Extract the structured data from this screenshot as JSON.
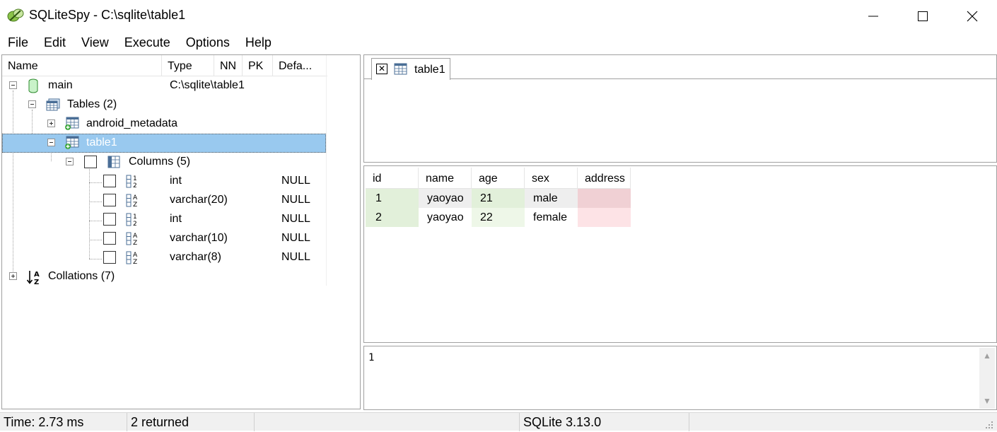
{
  "window": {
    "title": "SQLiteSpy - C:\\sqlite\\table1"
  },
  "menu": [
    "File",
    "Edit",
    "View",
    "Execute",
    "Options",
    "Help"
  ],
  "tree": {
    "columns": [
      "Name",
      "Type",
      "NN",
      "PK",
      "Defa..."
    ],
    "main": {
      "label": "main",
      "path": "C:\\sqlite\\table1"
    },
    "tables": {
      "label": "Tables (2)"
    },
    "android_metadata": {
      "label": "android_metadata"
    },
    "table1": {
      "label": "table1"
    },
    "columns_node": {
      "label": "Columns (5)"
    },
    "column_rows": [
      {
        "type": "int",
        "default": "NULL",
        "icon": "numeric-field-icon"
      },
      {
        "type": "varchar(20)",
        "default": "NULL",
        "icon": "text-field-icon"
      },
      {
        "type": "int",
        "default": "NULL",
        "icon": "numeric-field-icon"
      },
      {
        "type": "varchar(10)",
        "default": "NULL",
        "icon": "text-field-icon"
      },
      {
        "type": "varchar(8)",
        "default": "NULL",
        "icon": "text-field-icon"
      }
    ],
    "collations": {
      "label": "Collations (7)"
    }
  },
  "tab": {
    "label": "table1"
  },
  "grid": {
    "headers": [
      "id",
      "name",
      "age",
      "sex",
      "address"
    ],
    "rows": [
      [
        "1",
        "yaoyao",
        "21",
        "male",
        ""
      ],
      [
        "2",
        "yaoyao",
        "22",
        "female",
        ""
      ]
    ],
    "colors": {
      "int_cell": "#e2f0da",
      "int_cell_alt": "#eef7e8",
      "text_cell": "#eeeeee",
      "null_cell": "#f0d0d4",
      "null_cell_alt": "#fde3e6"
    }
  },
  "result": {
    "text": "1"
  },
  "status": {
    "time": "Time: 2.73 ms",
    "returned": "2 returned",
    "version": "SQLite 3.13.0"
  }
}
